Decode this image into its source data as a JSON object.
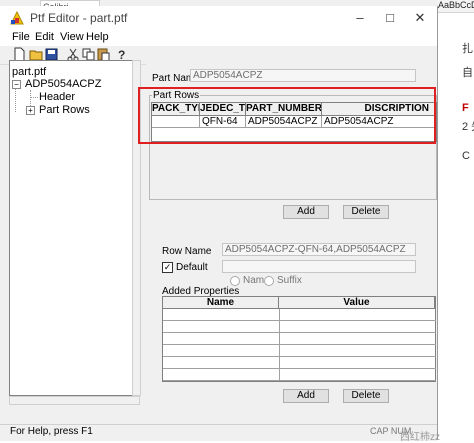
{
  "background_doc": {
    "font_box": "Calibri",
    "styles": "AaBbCcDd",
    "side_lines": [
      "扎",
      "自",
      "F",
      "2 先",
      "C"
    ]
  },
  "window": {
    "title": "Ptf Editor - part.ptf",
    "menu": [
      "File",
      "Edit",
      "View",
      "Help"
    ]
  },
  "tree": {
    "root": "part.ptf",
    "part": "ADP5054ACPZ",
    "children": [
      "Header",
      "Part Rows"
    ]
  },
  "form": {
    "part_name_label": "Part Name",
    "part_name_value": "ADP5054ACPZ",
    "part_rows_label": "Part Rows",
    "columns": [
      "PACK_TYPE",
      "JEDEC_TYP",
      "PART_NUMBER",
      "DISCRIPTION"
    ],
    "rows": [
      [
        "",
        "QFN-64",
        "ADP5054ACPZ",
        "ADP5054ACPZ"
      ]
    ],
    "add_label": "Add",
    "delete_label": "Delete",
    "row_name_label": "Row Name",
    "row_name_value": "ADP5054ACPZ-QFN-64,ADP5054ACPZ",
    "default_label": "Default",
    "name_radio": "Name",
    "suffix_radio": "Suffix",
    "added_props_label": "Added Properties",
    "prop_columns": [
      "Name",
      "Value"
    ],
    "add2_label": "Add",
    "delete2_label": "Delete"
  },
  "status": {
    "text": "For Help, press F1",
    "caps": "CAP  NUM",
    "watermark": "西红柿zz"
  }
}
